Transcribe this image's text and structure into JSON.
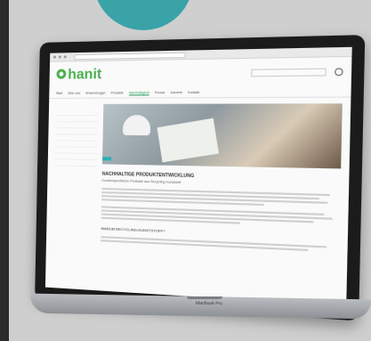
{
  "laptop": {
    "model_label": "MacBook Pro"
  },
  "website": {
    "brand": "hanit",
    "tagline": "",
    "search_placeholder": "",
    "nav": [
      "Start",
      "Über uns",
      "Anwendungen",
      "Produkte",
      "Nachhaltigkeit",
      "Presse",
      "Karriere",
      "Kontakt"
    ],
    "active_nav_index": 4,
    "sidebar": {
      "title": "",
      "items": [
        "",
        "",
        "",
        "",
        "",
        "",
        "",
        "",
        ""
      ],
      "selected_index": 4
    },
    "hero_badge": "",
    "heading": "NACHHALTIGE PRODUKTENTWICKLUNG",
    "subheading": "Kundenspezifische Produkte aus Recycling Kunststoff",
    "section_heading": "WARUM RECYCLING-KUNSTSTOFF?"
  }
}
